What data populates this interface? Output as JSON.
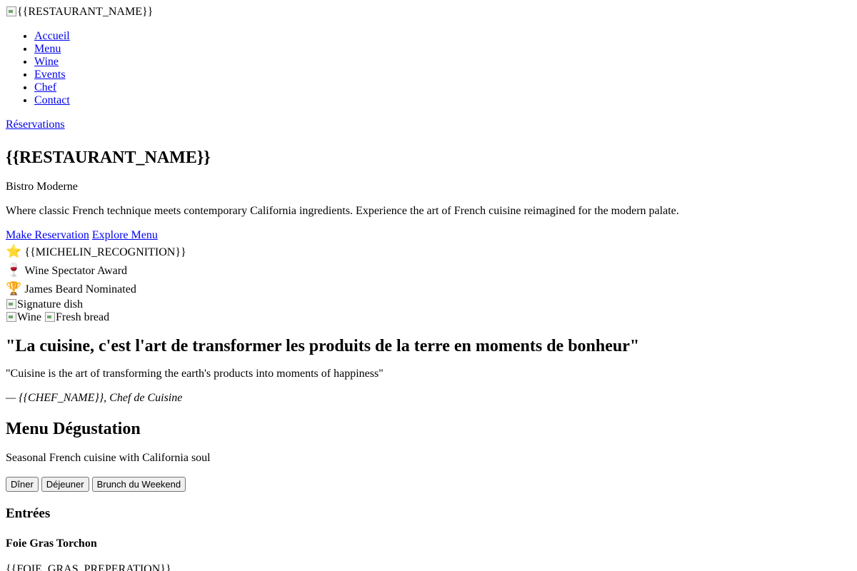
{
  "header": {
    "logo_alt": "{{RESTAURANT_NAME}}",
    "nav": [
      "Accueil",
      "Menu",
      "Wine",
      "Events",
      "Chef",
      "Contact"
    ],
    "reservations_link": "Réservations"
  },
  "hero": {
    "title": "{{RESTAURANT_NAME}}",
    "subtitle": "Bistro Moderne",
    "description": "Where classic French technique meets contemporary California ingredients. Experience the art of French cuisine reimagined for the modern palate.",
    "cta_primary": "Make Reservation",
    "cta_secondary": "Explore Menu"
  },
  "awards": [
    {
      "icon": "star-icon",
      "glyph": "⭐",
      "label": "{{MICHELIN_RECOGNITION}}"
    },
    {
      "icon": "wine-glass-icon",
      "glyph": "🍷",
      "label": "Wine Spectator Award"
    },
    {
      "icon": "trophy-icon",
      "glyph": "🏆",
      "label": "James Beard Nominated"
    }
  ],
  "gallery": {
    "signature_alt": "Signature dish",
    "wine_alt": "Wine",
    "bread_alt": "Fresh bread"
  },
  "quote": {
    "french": "\"La cuisine, c'est l'art de transformer les produits de la terre en moments de bonheur\"",
    "english": "\"Cuisine is the art of transforming the earth's products into moments of happiness\"",
    "attribution": "— {{CHEF_NAME}}, Chef de Cuisine"
  },
  "menu": {
    "title": "Menu Dégustation",
    "subtitle": "Seasonal French cuisine with California soul",
    "tabs": [
      "Dîner",
      "Déjeuner",
      "Brunch du Weekend"
    ],
    "section_title": "Entrées",
    "item_name": "Foie Gras Torchon",
    "item_desc": "{{FOIE_GRAS_PREPERATION}}"
  }
}
